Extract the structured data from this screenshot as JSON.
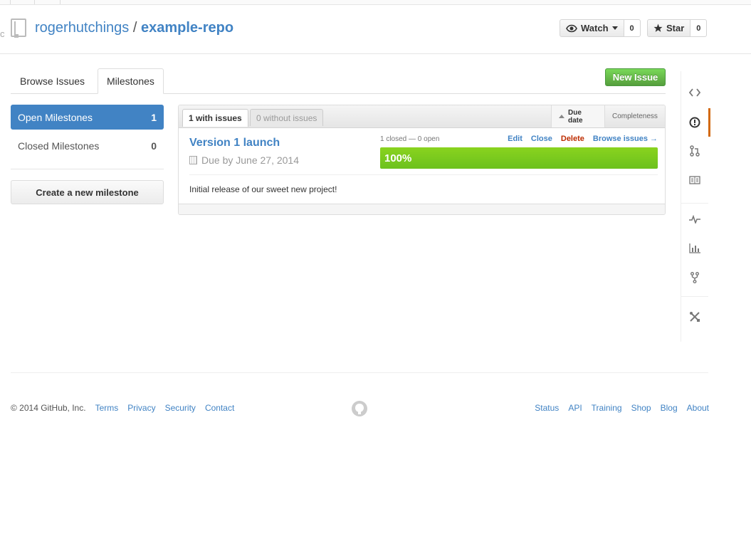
{
  "header": {
    "left_stub": "c",
    "owner": "rogerhutchings",
    "separator": "/",
    "repo": "example-repo",
    "watch": {
      "label": "Watch",
      "count": "0"
    },
    "star": {
      "label": "Star",
      "count": "0"
    }
  },
  "tabs": {
    "browse": "Browse Issues",
    "milestones": "Milestones"
  },
  "new_issue": "New Issue",
  "sidebar": {
    "open": {
      "label": "Open Milestones",
      "count": "1"
    },
    "closed": {
      "label": "Closed Milestones",
      "count": "0"
    },
    "create": "Create a new milestone"
  },
  "panel": {
    "tab_with": "1 with issues",
    "tab_without": "0 without issues",
    "sort_due": "Due date",
    "sort_completeness": "Completeness",
    "milestone": {
      "title": "Version 1 launch",
      "due": "Due by June 27, 2014",
      "stats": "1 closed — 0 open",
      "actions": {
        "edit": "Edit",
        "close": "Close",
        "delete": "Delete",
        "browse": "Browse issues →"
      },
      "progress_label": "100%",
      "progress_fraction": 1.0,
      "description": "Initial release of our sweet new project!"
    }
  },
  "right_nav": [
    "code-icon",
    "issues-icon",
    "pull-request-icon",
    "wiki-icon",
    "pulse-icon",
    "graphs-icon",
    "network-icon",
    "settings-icon"
  ],
  "footer": {
    "copyright": "© 2014 GitHub, Inc.",
    "left_links": [
      "Terms",
      "Privacy",
      "Security",
      "Contact"
    ],
    "right_links": [
      "Status",
      "API",
      "Training",
      "Shop",
      "Blog",
      "About"
    ]
  },
  "colors": {
    "link": "#4183c4",
    "open_filter_bg": "#4183c4",
    "new_issue_green": "#6cc644",
    "progress_green": "#6cc11d",
    "delete_red": "#bd2c00",
    "active_nav_orange": "#d26911"
  }
}
